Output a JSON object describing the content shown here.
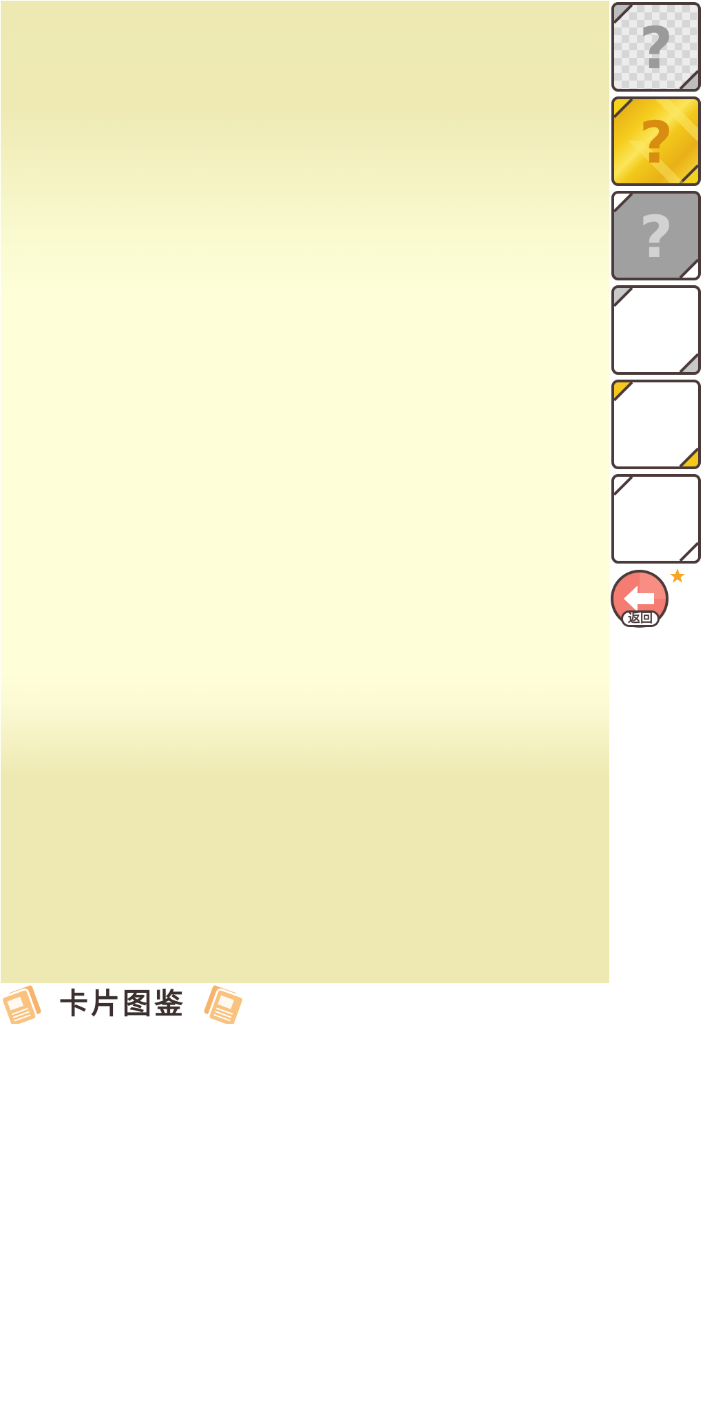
{
  "colors": {
    "background_panel_light": "#feffd9",
    "background_panel_dark": "#eee9b2",
    "card_border": "#4a3b3a",
    "silver_card": "#ececec",
    "gold_card": "#f6cc1e",
    "gray_card": "#a0a0a0",
    "back_button": "#f47c72",
    "star": "#f5a623",
    "title_icon": "#f7b36b"
  },
  "cards": [
    {
      "id": "silver-unknown",
      "tier": "silver",
      "symbol": "?",
      "icon": "question-mark-icon"
    },
    {
      "id": "gold-unknown",
      "tier": "gold",
      "symbol": "?",
      "icon": "question-mark-icon"
    },
    {
      "id": "gray-unknown",
      "tier": "gray",
      "symbol": "?",
      "icon": "question-mark-icon"
    },
    {
      "id": "silver-frame",
      "tier": "silver",
      "symbol": "",
      "icon": ""
    },
    {
      "id": "gold-frame",
      "tier": "gold",
      "symbol": "",
      "icon": ""
    },
    {
      "id": "plain-frame",
      "tier": "plain",
      "symbol": "",
      "icon": ""
    }
  ],
  "back_button": {
    "label": "返回",
    "icon": "arrow-left-icon"
  },
  "star": {
    "icon": "star-icon"
  },
  "title": {
    "text": "卡片图鉴",
    "icon": "card-stack-icon"
  }
}
